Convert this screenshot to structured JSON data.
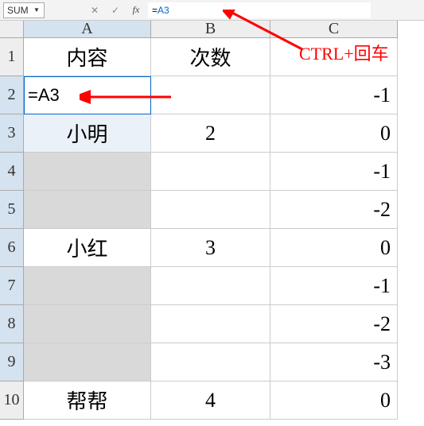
{
  "formulaBar": {
    "nameBox": "SUM",
    "cancel": "✕",
    "confirm": "✓",
    "fx": "fx",
    "formulaEq": "=",
    "formulaRef": "A3"
  },
  "columns": [
    "A",
    "B",
    "C"
  ],
  "rows": [
    {
      "n": "1",
      "a": "内容",
      "b": "次数",
      "c": "CTRL+回车",
      "aClass": "",
      "bClass": "",
      "cClass": "annotation-cell"
    },
    {
      "n": "2",
      "a": "=A3",
      "b": "",
      "c": "-1",
      "aClass": "editing alignleft",
      "bClass": "",
      "cClass": "alignright"
    },
    {
      "n": "3",
      "a": "小明",
      "b": "2",
      "c": "0",
      "aClass": "lightblue",
      "bClass": "center-num",
      "cClass": "alignright"
    },
    {
      "n": "4",
      "a": "",
      "b": "",
      "c": "-1",
      "aClass": "shaded",
      "bClass": "",
      "cClass": "alignright"
    },
    {
      "n": "5",
      "a": "",
      "b": "",
      "c": "-2",
      "aClass": "shaded",
      "bClass": "",
      "cClass": "alignright"
    },
    {
      "n": "6",
      "a": "小红",
      "b": "3",
      "c": "0",
      "aClass": "",
      "bClass": "center-num",
      "cClass": "alignright"
    },
    {
      "n": "7",
      "a": "",
      "b": "",
      "c": "-1",
      "aClass": "shaded",
      "bClass": "",
      "cClass": "alignright"
    },
    {
      "n": "8",
      "a": "",
      "b": "",
      "c": "-2",
      "aClass": "shaded",
      "bClass": "",
      "cClass": "alignright"
    },
    {
      "n": "9",
      "a": "",
      "b": "",
      "c": "-3",
      "aClass": "shaded",
      "bClass": "",
      "cClass": "alignright"
    },
    {
      "n": "10",
      "a": "帮帮",
      "b": "4",
      "c": "0",
      "aClass": "",
      "bClass": "center-num",
      "cClass": "alignright"
    }
  ],
  "annotation": "CTRL+回车"
}
